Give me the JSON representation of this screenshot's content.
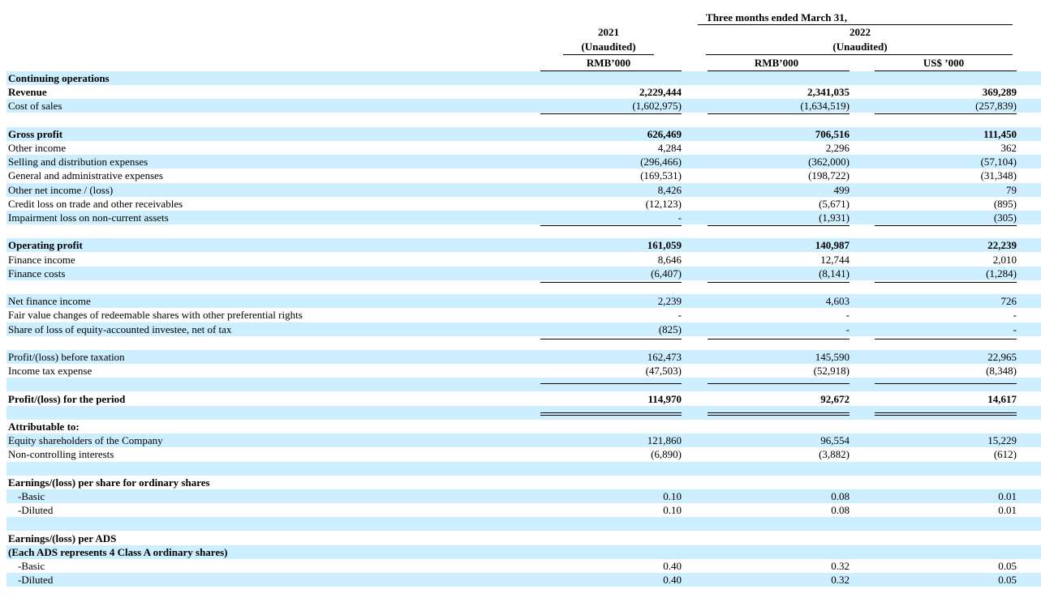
{
  "header": {
    "period": "Three months ended March 31,",
    "year_2021": "2021",
    "year_2022": "2022",
    "unaudited_2021": "(Unaudited)",
    "unaudited_2022": "(Unaudited)",
    "col1_unit": "RMB’000",
    "col2_unit": "RMB’000",
    "col3_unit": "US$ ’000"
  },
  "rows": [
    {
      "label": "Continuing operations",
      "bold": true,
      "c1": "",
      "c2": "",
      "c3": ""
    },
    {
      "label": "Revenue",
      "bold": true,
      "c1": "2,229,444",
      "c2": "2,341,035",
      "c3": "369,289"
    },
    {
      "label": "Cost of sales",
      "c1": "(1,602,975)",
      "c2": "(1,634,519)",
      "c3": "(257,839)"
    },
    {
      "label": "",
      "c1": "",
      "c2": "",
      "c3": ""
    },
    {
      "label": "Gross profit",
      "bold": true,
      "c1": "626,469",
      "c2": "706,516",
      "c3": "111,450"
    },
    {
      "label": "Other income",
      "c1": "4,284",
      "c2": "2,296",
      "c3": "362"
    },
    {
      "label": "Selling and distribution expenses",
      "c1": "(296,466)",
      "c2": "(362,000)",
      "c3": "(57,104)"
    },
    {
      "label": "General and administrative expenses",
      "c1": "(169,531)",
      "c2": "(198,722)",
      "c3": "(31,348)"
    },
    {
      "label": "Other net income / (loss)",
      "c1": "8,426",
      "c2": "499",
      "c3": "79"
    },
    {
      "label": "Credit loss on trade and other receivables",
      "c1": "(12,123)",
      "c2": "(5,671)",
      "c3": "(895)"
    },
    {
      "label": "Impairment loss on non-current assets",
      "c1": "-",
      "c2": "(1,931)",
      "c3": "(305)"
    },
    {
      "label": "",
      "c1": "",
      "c2": "",
      "c3": ""
    },
    {
      "label": "Operating profit",
      "bold": true,
      "c1": "161,059",
      "c2": "140,987",
      "c3": "22,239"
    },
    {
      "label": "Finance income",
      "c1": "8,646",
      "c2": "12,744",
      "c3": "2,010"
    },
    {
      "label": "Finance costs",
      "c1": "(6,407)",
      "c2": "(8,141)",
      "c3": "(1,284)"
    },
    {
      "label": "",
      "c1": "",
      "c2": "",
      "c3": ""
    },
    {
      "label": "Net finance income",
      "c1": "2,239",
      "c2": "4,603",
      "c3": "726"
    },
    {
      "label": "Fair value changes of redeemable shares with other preferential rights",
      "c1": "-",
      "c2": "-",
      "c3": "-"
    },
    {
      "label": "Share of loss of equity-accounted investee, net of tax",
      "c1": "(825)",
      "c2": "-",
      "c3": "-"
    },
    {
      "label": "",
      "c1": "",
      "c2": "",
      "c3": ""
    },
    {
      "label": "Profit/(loss) before taxation",
      "c1": "162,473",
      "c2": "145,590",
      "c3": "22,965"
    },
    {
      "label": "Income tax expense",
      "c1": "(47,503)",
      "c2": "(52,918)",
      "c3": "(8,348)"
    },
    {
      "label": "",
      "c1": "",
      "c2": "",
      "c3": ""
    },
    {
      "label": "Profit/(loss) for the period",
      "bold": true,
      "c1": "114,970",
      "c2": "92,672",
      "c3": "14,617"
    },
    {
      "label": "",
      "c1": "",
      "c2": "",
      "c3": ""
    },
    {
      "label": "Attributable to:",
      "bold": true,
      "c1": "",
      "c2": "",
      "c3": ""
    },
    {
      "label": "Equity shareholders of the Company",
      "c1": "121,860",
      "c2": "96,554",
      "c3": "15,229"
    },
    {
      "label": "Non-controlling interests",
      "c1": "(6,890)",
      "c2": "(3,882)",
      "c3": "(612)"
    },
    {
      "label": "",
      "c1": "",
      "c2": "",
      "c3": ""
    },
    {
      "label": "Earnings/(loss) per share for ordinary shares",
      "bold": true,
      "c1": "",
      "c2": "",
      "c3": ""
    },
    {
      "label": "-Basic",
      "indent": true,
      "c1": "0.10",
      "c2": "0.08",
      "c3": "0.01"
    },
    {
      "label": "-Diluted",
      "indent": true,
      "c1": "0.10",
      "c2": "0.08",
      "c3": "0.01"
    },
    {
      "label": "",
      "c1": "",
      "c2": "",
      "c3": ""
    },
    {
      "label": "Earnings/(loss) per ADS",
      "bold": true,
      "c1": "",
      "c2": "",
      "c3": ""
    },
    {
      "label": "(Each ADS represents 4 Class A ordinary shares)",
      "bold": true,
      "c1": "",
      "c2": "",
      "c3": ""
    },
    {
      "label": "-Basic",
      "indent": true,
      "c1": "0.40",
      "c2": "0.32",
      "c3": "0.05"
    },
    {
      "label": "-Diluted",
      "indent": true,
      "c1": "0.40",
      "c2": "0.32",
      "c3": "0.05"
    }
  ]
}
